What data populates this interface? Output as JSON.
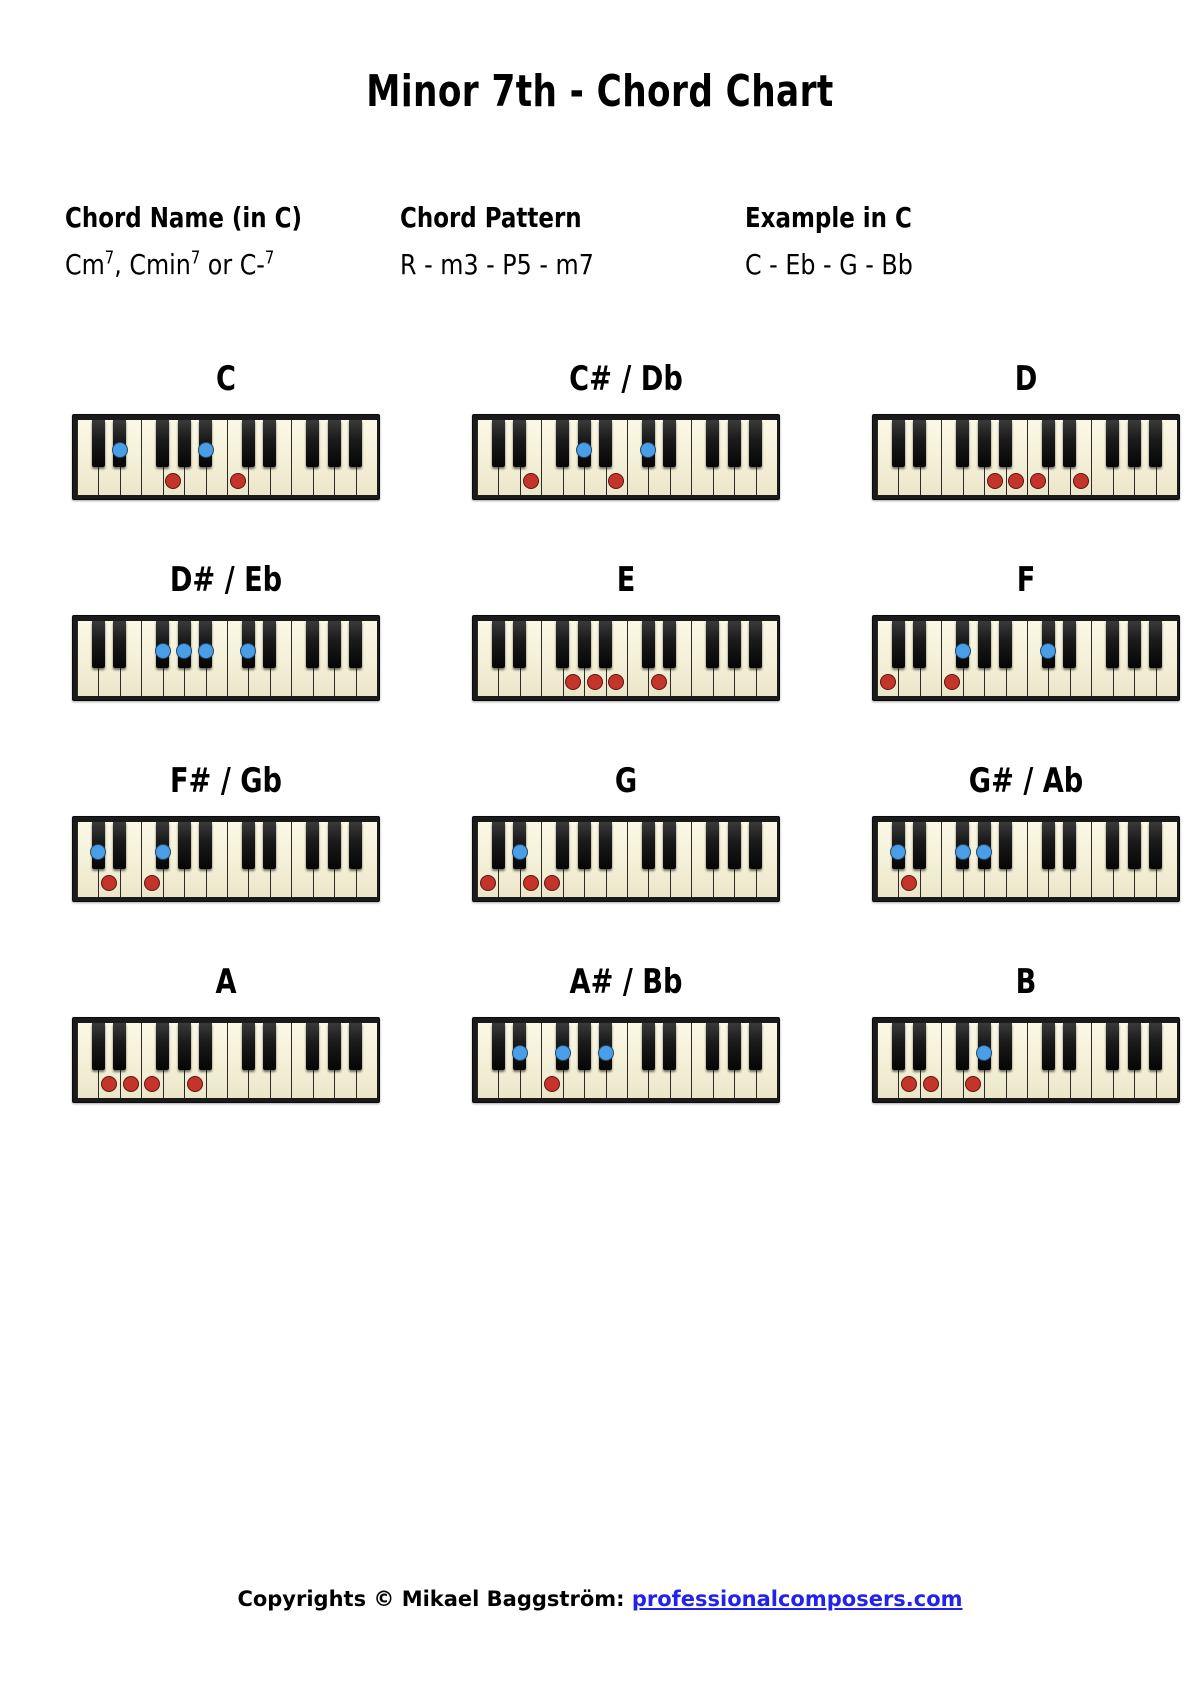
{
  "title": "Minor 7th - Chord Chart",
  "info": {
    "columns": [
      {
        "header": "Chord Name (in C)",
        "value_html": "Cm<sup>7</sup>, Cmin<sup>7</sup> or C-<sup>7</sup>",
        "value_text": "Cm7, Cmin7 or C-7"
      },
      {
        "header": "Chord Pattern",
        "value_html": "R - m3 - P5 - m7",
        "value_text": "R - m3 - P5 - m7"
      },
      {
        "header": "Example in C",
        "value_html": "C - Eb - G - Bb",
        "value_text": "C - Eb - G - Bb"
      }
    ]
  },
  "colors": {
    "dot_blue": "#4a9ee8",
    "dot_red": "#c5342a",
    "white_key": "#f5f2dc",
    "black_key": "#101010",
    "frame": "#1a1a1a",
    "link": "#2222ee"
  },
  "keyboard": {
    "white_key_count": 14,
    "octaves": 2,
    "black_key_pattern": [
      1,
      1,
      0,
      1,
      1,
      1,
      0
    ],
    "note_names_white": [
      "C",
      "D",
      "E",
      "F",
      "G",
      "A",
      "B",
      "C",
      "D",
      "E",
      "F",
      "G",
      "A",
      "B"
    ],
    "note_names_black": [
      "C#",
      "D#",
      "F#",
      "G#",
      "A#",
      "C#",
      "D#",
      "F#",
      "G#",
      "A#"
    ]
  },
  "chord_data": {
    "type": "table",
    "chord_quality": "Minor 7th",
    "formula": "R - m3 - P5 - m7",
    "semitones": [
      0,
      3,
      7,
      10
    ],
    "chords": [
      {
        "label": "C",
        "root": "C",
        "notes": [
          "C",
          "Eb",
          "G",
          "Bb"
        ],
        "marks": [
          {
            "type": "black",
            "index": 1,
            "color": "blue",
            "note": "D#/Eb"
          },
          {
            "type": "white",
            "index": 4,
            "color": "red",
            "note": "G"
          },
          {
            "type": "black",
            "index": 4,
            "color": "blue",
            "note": "A#/Bb"
          },
          {
            "type": "white",
            "index": 7,
            "color": "red",
            "note": "C"
          }
        ]
      },
      {
        "label": "C# / Db",
        "root": "C#",
        "notes": [
          "C#",
          "E",
          "G#",
          "B"
        ],
        "marks": [
          {
            "type": "white",
            "index": 2,
            "color": "red",
            "note": "E"
          },
          {
            "type": "black",
            "index": 3,
            "color": "blue",
            "note": "G#/Ab"
          },
          {
            "type": "white",
            "index": 6,
            "color": "red",
            "note": "B"
          },
          {
            "type": "black",
            "index": 5,
            "color": "blue",
            "note": "C#/Db"
          }
        ]
      },
      {
        "label": "D",
        "root": "D",
        "notes": [
          "D",
          "F",
          "A",
          "C"
        ],
        "marks": [
          {
            "type": "white",
            "index": 5,
            "color": "red",
            "note": "A"
          },
          {
            "type": "white",
            "index": 6,
            "color": "red",
            "note": "B"
          },
          {
            "type": "white",
            "index": 7,
            "color": "red",
            "note": "C"
          },
          {
            "type": "white",
            "index": 9,
            "color": "red",
            "note": "D"
          }
        ]
      },
      {
        "label": "D# / Eb",
        "root": "D#",
        "notes": [
          "Eb",
          "Gb",
          "Bb",
          "Db"
        ],
        "marks": [
          {
            "type": "black",
            "index": 2,
            "color": "blue",
            "note": "F#/Gb"
          },
          {
            "type": "black",
            "index": 3,
            "color": "blue",
            "note": "G#/Ab"
          },
          {
            "type": "black",
            "index": 4,
            "color": "blue",
            "note": "A#/Bb"
          },
          {
            "type": "black",
            "index": 5,
            "color": "blue",
            "note": "C#/Db"
          }
        ]
      },
      {
        "label": "E",
        "root": "E",
        "notes": [
          "E",
          "G",
          "B",
          "D"
        ],
        "marks": [
          {
            "type": "white",
            "index": 4,
            "color": "red",
            "note": "G"
          },
          {
            "type": "white",
            "index": 5,
            "color": "red",
            "note": "A"
          },
          {
            "type": "white",
            "index": 6,
            "color": "red",
            "note": "B"
          },
          {
            "type": "white",
            "index": 8,
            "color": "red",
            "note": "D"
          }
        ]
      },
      {
        "label": "F",
        "root": "F",
        "notes": [
          "F",
          "Ab",
          "C",
          "Eb"
        ],
        "marks": [
          {
            "type": "white",
            "index": 0,
            "color": "red",
            "note": "C"
          },
          {
            "type": "black",
            "index": 2,
            "color": "blue",
            "note": "F#/Gb"
          },
          {
            "type": "white",
            "index": 3,
            "color": "red",
            "note": "F"
          },
          {
            "type": "black",
            "index": 5,
            "color": "blue",
            "note": "C#/Db"
          }
        ]
      },
      {
        "label": "F# / Gb",
        "root": "F#",
        "notes": [
          "F#",
          "A",
          "C#",
          "E"
        ],
        "marks": [
          {
            "type": "black",
            "index": 0,
            "color": "blue",
            "note": "C#/Db"
          },
          {
            "type": "white",
            "index": 1,
            "color": "red",
            "note": "D"
          },
          {
            "type": "black",
            "index": 2,
            "color": "blue",
            "note": "F#/Gb"
          },
          {
            "type": "white",
            "index": 3,
            "color": "red",
            "note": "F"
          }
        ]
      },
      {
        "label": "G",
        "root": "G",
        "notes": [
          "G",
          "Bb",
          "D",
          "F"
        ],
        "marks": [
          {
            "type": "white",
            "index": 0,
            "color": "red",
            "note": "C"
          },
          {
            "type": "black",
            "index": 1,
            "color": "blue",
            "note": "D#/Eb"
          },
          {
            "type": "white",
            "index": 2,
            "color": "red",
            "note": "E"
          },
          {
            "type": "white",
            "index": 3,
            "color": "red",
            "note": "F"
          }
        ]
      },
      {
        "label": "G# / Ab",
        "root": "G#",
        "notes": [
          "Ab",
          "B",
          "Eb",
          "Gb"
        ],
        "marks": [
          {
            "type": "black",
            "index": 0,
            "color": "blue",
            "note": "C#/Db"
          },
          {
            "type": "white",
            "index": 1,
            "color": "red",
            "note": "D"
          },
          {
            "type": "black",
            "index": 2,
            "color": "blue",
            "note": "F#/Gb"
          },
          {
            "type": "black",
            "index": 3,
            "color": "blue",
            "note": "G#/Ab"
          }
        ]
      },
      {
        "label": "A",
        "root": "A",
        "notes": [
          "A",
          "C",
          "E",
          "G"
        ],
        "marks": [
          {
            "type": "white",
            "index": 1,
            "color": "red",
            "note": "D"
          },
          {
            "type": "white",
            "index": 2,
            "color": "red",
            "note": "E"
          },
          {
            "type": "white",
            "index": 3,
            "color": "red",
            "note": "F"
          },
          {
            "type": "white",
            "index": 5,
            "color": "red",
            "note": "A"
          }
        ]
      },
      {
        "label": "A# / Bb",
        "root": "A#",
        "notes": [
          "Bb",
          "Db",
          "F",
          "Ab"
        ],
        "marks": [
          {
            "type": "black",
            "index": 1,
            "color": "blue",
            "note": "D#/Eb"
          },
          {
            "type": "black",
            "index": 2,
            "color": "blue",
            "note": "F#/Gb"
          },
          {
            "type": "white",
            "index": 3,
            "color": "red",
            "note": "F"
          },
          {
            "type": "black",
            "index": 4,
            "color": "blue",
            "note": "A#/Bb"
          }
        ]
      },
      {
        "label": "B",
        "root": "B",
        "notes": [
          "B",
          "D",
          "F#",
          "A"
        ],
        "marks": [
          {
            "type": "white",
            "index": 1,
            "color": "red",
            "note": "D"
          },
          {
            "type": "white",
            "index": 2,
            "color": "red",
            "note": "E"
          },
          {
            "type": "white",
            "index": 4,
            "color": "red",
            "note": "G"
          },
          {
            "type": "black",
            "index": 3,
            "color": "blue",
            "note": "G#/Ab"
          }
        ]
      }
    ]
  },
  "footer": {
    "text": "Copyrights © Mikael Baggström: ",
    "link_text": "professionalcomposers.com"
  }
}
